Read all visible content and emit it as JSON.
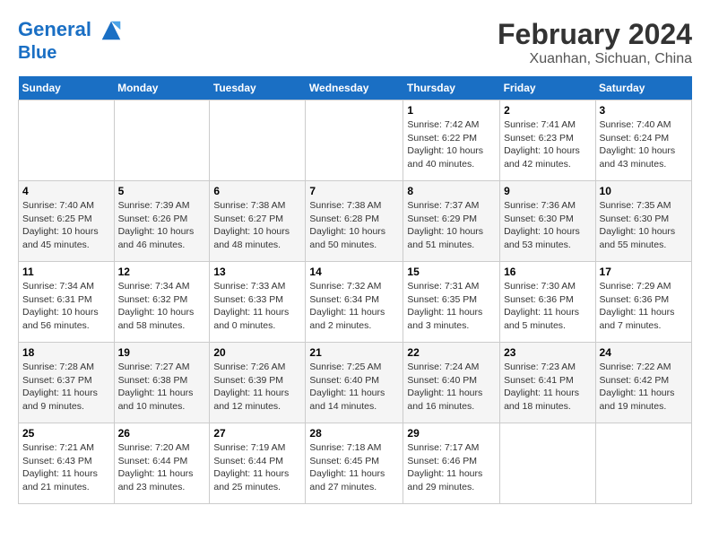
{
  "header": {
    "logo_line1": "General",
    "logo_line2": "Blue",
    "main_title": "February 2024",
    "sub_title": "Xuanhan, Sichuan, China"
  },
  "days_of_week": [
    "Sunday",
    "Monday",
    "Tuesday",
    "Wednesday",
    "Thursday",
    "Friday",
    "Saturday"
  ],
  "weeks": [
    [
      {
        "num": "",
        "info": ""
      },
      {
        "num": "",
        "info": ""
      },
      {
        "num": "",
        "info": ""
      },
      {
        "num": "",
        "info": ""
      },
      {
        "num": "1",
        "info": "Sunrise: 7:42 AM\nSunset: 6:22 PM\nDaylight: 10 hours\nand 40 minutes."
      },
      {
        "num": "2",
        "info": "Sunrise: 7:41 AM\nSunset: 6:23 PM\nDaylight: 10 hours\nand 42 minutes."
      },
      {
        "num": "3",
        "info": "Sunrise: 7:40 AM\nSunset: 6:24 PM\nDaylight: 10 hours\nand 43 minutes."
      }
    ],
    [
      {
        "num": "4",
        "info": "Sunrise: 7:40 AM\nSunset: 6:25 PM\nDaylight: 10 hours\nand 45 minutes."
      },
      {
        "num": "5",
        "info": "Sunrise: 7:39 AM\nSunset: 6:26 PM\nDaylight: 10 hours\nand 46 minutes."
      },
      {
        "num": "6",
        "info": "Sunrise: 7:38 AM\nSunset: 6:27 PM\nDaylight: 10 hours\nand 48 minutes."
      },
      {
        "num": "7",
        "info": "Sunrise: 7:38 AM\nSunset: 6:28 PM\nDaylight: 10 hours\nand 50 minutes."
      },
      {
        "num": "8",
        "info": "Sunrise: 7:37 AM\nSunset: 6:29 PM\nDaylight: 10 hours\nand 51 minutes."
      },
      {
        "num": "9",
        "info": "Sunrise: 7:36 AM\nSunset: 6:30 PM\nDaylight: 10 hours\nand 53 minutes."
      },
      {
        "num": "10",
        "info": "Sunrise: 7:35 AM\nSunset: 6:30 PM\nDaylight: 10 hours\nand 55 minutes."
      }
    ],
    [
      {
        "num": "11",
        "info": "Sunrise: 7:34 AM\nSunset: 6:31 PM\nDaylight: 10 hours\nand 56 minutes."
      },
      {
        "num": "12",
        "info": "Sunrise: 7:34 AM\nSunset: 6:32 PM\nDaylight: 10 hours\nand 58 minutes."
      },
      {
        "num": "13",
        "info": "Sunrise: 7:33 AM\nSunset: 6:33 PM\nDaylight: 11 hours\nand 0 minutes."
      },
      {
        "num": "14",
        "info": "Sunrise: 7:32 AM\nSunset: 6:34 PM\nDaylight: 11 hours\nand 2 minutes."
      },
      {
        "num": "15",
        "info": "Sunrise: 7:31 AM\nSunset: 6:35 PM\nDaylight: 11 hours\nand 3 minutes."
      },
      {
        "num": "16",
        "info": "Sunrise: 7:30 AM\nSunset: 6:36 PM\nDaylight: 11 hours\nand 5 minutes."
      },
      {
        "num": "17",
        "info": "Sunrise: 7:29 AM\nSunset: 6:36 PM\nDaylight: 11 hours\nand 7 minutes."
      }
    ],
    [
      {
        "num": "18",
        "info": "Sunrise: 7:28 AM\nSunset: 6:37 PM\nDaylight: 11 hours\nand 9 minutes."
      },
      {
        "num": "19",
        "info": "Sunrise: 7:27 AM\nSunset: 6:38 PM\nDaylight: 11 hours\nand 10 minutes."
      },
      {
        "num": "20",
        "info": "Sunrise: 7:26 AM\nSunset: 6:39 PM\nDaylight: 11 hours\nand 12 minutes."
      },
      {
        "num": "21",
        "info": "Sunrise: 7:25 AM\nSunset: 6:40 PM\nDaylight: 11 hours\nand 14 minutes."
      },
      {
        "num": "22",
        "info": "Sunrise: 7:24 AM\nSunset: 6:40 PM\nDaylight: 11 hours\nand 16 minutes."
      },
      {
        "num": "23",
        "info": "Sunrise: 7:23 AM\nSunset: 6:41 PM\nDaylight: 11 hours\nand 18 minutes."
      },
      {
        "num": "24",
        "info": "Sunrise: 7:22 AM\nSunset: 6:42 PM\nDaylight: 11 hours\nand 19 minutes."
      }
    ],
    [
      {
        "num": "25",
        "info": "Sunrise: 7:21 AM\nSunset: 6:43 PM\nDaylight: 11 hours\nand 21 minutes."
      },
      {
        "num": "26",
        "info": "Sunrise: 7:20 AM\nSunset: 6:44 PM\nDaylight: 11 hours\nand 23 minutes."
      },
      {
        "num": "27",
        "info": "Sunrise: 7:19 AM\nSunset: 6:44 PM\nDaylight: 11 hours\nand 25 minutes."
      },
      {
        "num": "28",
        "info": "Sunrise: 7:18 AM\nSunset: 6:45 PM\nDaylight: 11 hours\nand 27 minutes."
      },
      {
        "num": "29",
        "info": "Sunrise: 7:17 AM\nSunset: 6:46 PM\nDaylight: 11 hours\nand 29 minutes."
      },
      {
        "num": "",
        "info": ""
      },
      {
        "num": "",
        "info": ""
      }
    ]
  ]
}
